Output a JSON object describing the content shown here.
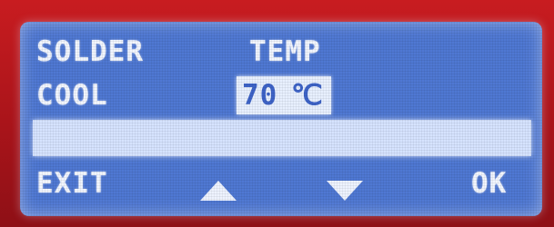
{
  "screen": {
    "row1": {
      "label": "SOLDER",
      "title": "TEMP"
    },
    "row2": {
      "label": "COOL",
      "value": "70",
      "unit": "℃"
    },
    "progress": {
      "fill_fraction": 1.0
    },
    "softkeys": {
      "exit": "EXIT",
      "up_icon": "triangle-up-icon",
      "down_icon": "triangle-down-icon",
      "ok": "OK"
    }
  },
  "colors": {
    "frame": "#b3161a",
    "lcd_background": "#4f78d3",
    "lcd_text": "#f2f6ff",
    "highlight": "#e8f0ff",
    "bar": "#d6e3ff"
  }
}
